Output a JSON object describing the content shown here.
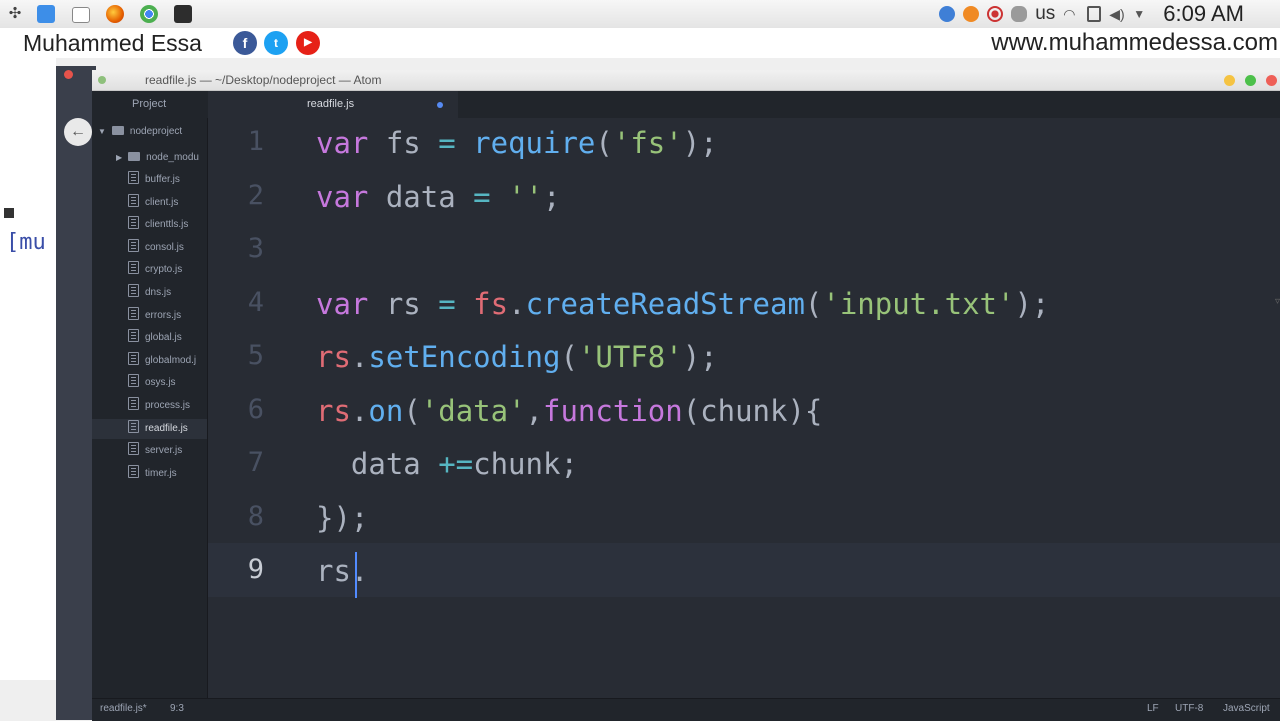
{
  "top_bar": {
    "keyboard_layout": "us",
    "clock": "6:09 AM",
    "launcher_icons": [
      "apps-menu-icon",
      "file-manager-icon",
      "screenshot-icon",
      "firefox-icon",
      "chrome-icon",
      "terminal-icon"
    ],
    "tray_icons": [
      "sync-icon",
      "vlc-icon",
      "record-icon",
      "network-users-icon",
      "wifi-icon",
      "clipboard-icon",
      "volume-icon",
      "dropdown-icon"
    ]
  },
  "banner": {
    "author": "Muhammed Essa",
    "website": "www.muhammedessa.com",
    "social": [
      {
        "name": "facebook-icon",
        "glyph": "f",
        "color": "#3b5998"
      },
      {
        "name": "twitter-icon",
        "glyph": "t",
        "color": "#1da1f2"
      },
      {
        "name": "youtube-icon",
        "glyph": "▶",
        "color": "#e62117"
      }
    ]
  },
  "window": {
    "title": "readfile.js — ~/Desktop/nodeproject — Atom"
  },
  "tabs": {
    "project_label": "Project",
    "file_label": "readfile.js"
  },
  "tree": {
    "root": "nodeproject",
    "folder": "node_modu",
    "files": [
      "buffer.js",
      "client.js",
      "clienttls.js",
      "consol.js",
      "crypto.js",
      "dns.js",
      "errors.js",
      "global.js",
      "globalmod.j",
      "osys.js",
      "process.js",
      "readfile.js",
      "server.js",
      "timer.js"
    ],
    "active_file": "readfile.js"
  },
  "editor": {
    "line_numbers": [
      "1",
      "2",
      "3",
      "4",
      "5",
      "6",
      "7",
      "8",
      "9"
    ],
    "current_line": "9",
    "lines": [
      [
        {
          "t": "var",
          "c": "kw"
        },
        {
          "t": " fs ",
          "c": "id"
        },
        {
          "t": "=",
          "c": "op"
        },
        {
          "t": " ",
          "c": "id"
        },
        {
          "t": "require",
          "c": "fn"
        },
        {
          "t": "(",
          "c": "pun"
        },
        {
          "t": "'fs'",
          "c": "str"
        },
        {
          "t": ");",
          "c": "pun"
        }
      ],
      [
        {
          "t": "var",
          "c": "kw"
        },
        {
          "t": " data ",
          "c": "id"
        },
        {
          "t": "=",
          "c": "op"
        },
        {
          "t": " ",
          "c": "id"
        },
        {
          "t": "''",
          "c": "str"
        },
        {
          "t": ";",
          "c": "pun"
        }
      ],
      [],
      [
        {
          "t": "var",
          "c": "kw"
        },
        {
          "t": " rs ",
          "c": "id"
        },
        {
          "t": "=",
          "c": "op"
        },
        {
          "t": " ",
          "c": "id"
        },
        {
          "t": "fs",
          "c": "var"
        },
        {
          "t": ".",
          "c": "pun"
        },
        {
          "t": "createReadStream",
          "c": "fn"
        },
        {
          "t": "(",
          "c": "pun"
        },
        {
          "t": "'input.txt'",
          "c": "str"
        },
        {
          "t": ");",
          "c": "pun"
        }
      ],
      [
        {
          "t": "rs",
          "c": "var"
        },
        {
          "t": ".",
          "c": "pun"
        },
        {
          "t": "setEncoding",
          "c": "fn"
        },
        {
          "t": "(",
          "c": "pun"
        },
        {
          "t": "'UTF8'",
          "c": "str"
        },
        {
          "t": ");",
          "c": "pun"
        }
      ],
      [
        {
          "t": "rs",
          "c": "var"
        },
        {
          "t": ".",
          "c": "pun"
        },
        {
          "t": "on",
          "c": "fn"
        },
        {
          "t": "(",
          "c": "pun"
        },
        {
          "t": "'data'",
          "c": "str"
        },
        {
          "t": ",",
          "c": "pun"
        },
        {
          "t": "function",
          "c": "kw"
        },
        {
          "t": "(chunk){",
          "c": "pun"
        }
      ],
      [
        {
          "t": "  data ",
          "c": "id"
        },
        {
          "t": "+=",
          "c": "op"
        },
        {
          "t": "chunk;",
          "c": "id"
        }
      ],
      [
        {
          "t": "});",
          "c": "pun"
        }
      ],
      [
        {
          "t": "rs.",
          "c": "id"
        }
      ]
    ]
  },
  "status_bar": {
    "file": "readfile.js*",
    "cursor_position": "9:3",
    "line_ending": "LF",
    "encoding": "UTF-8",
    "grammar": "JavaScript"
  }
}
